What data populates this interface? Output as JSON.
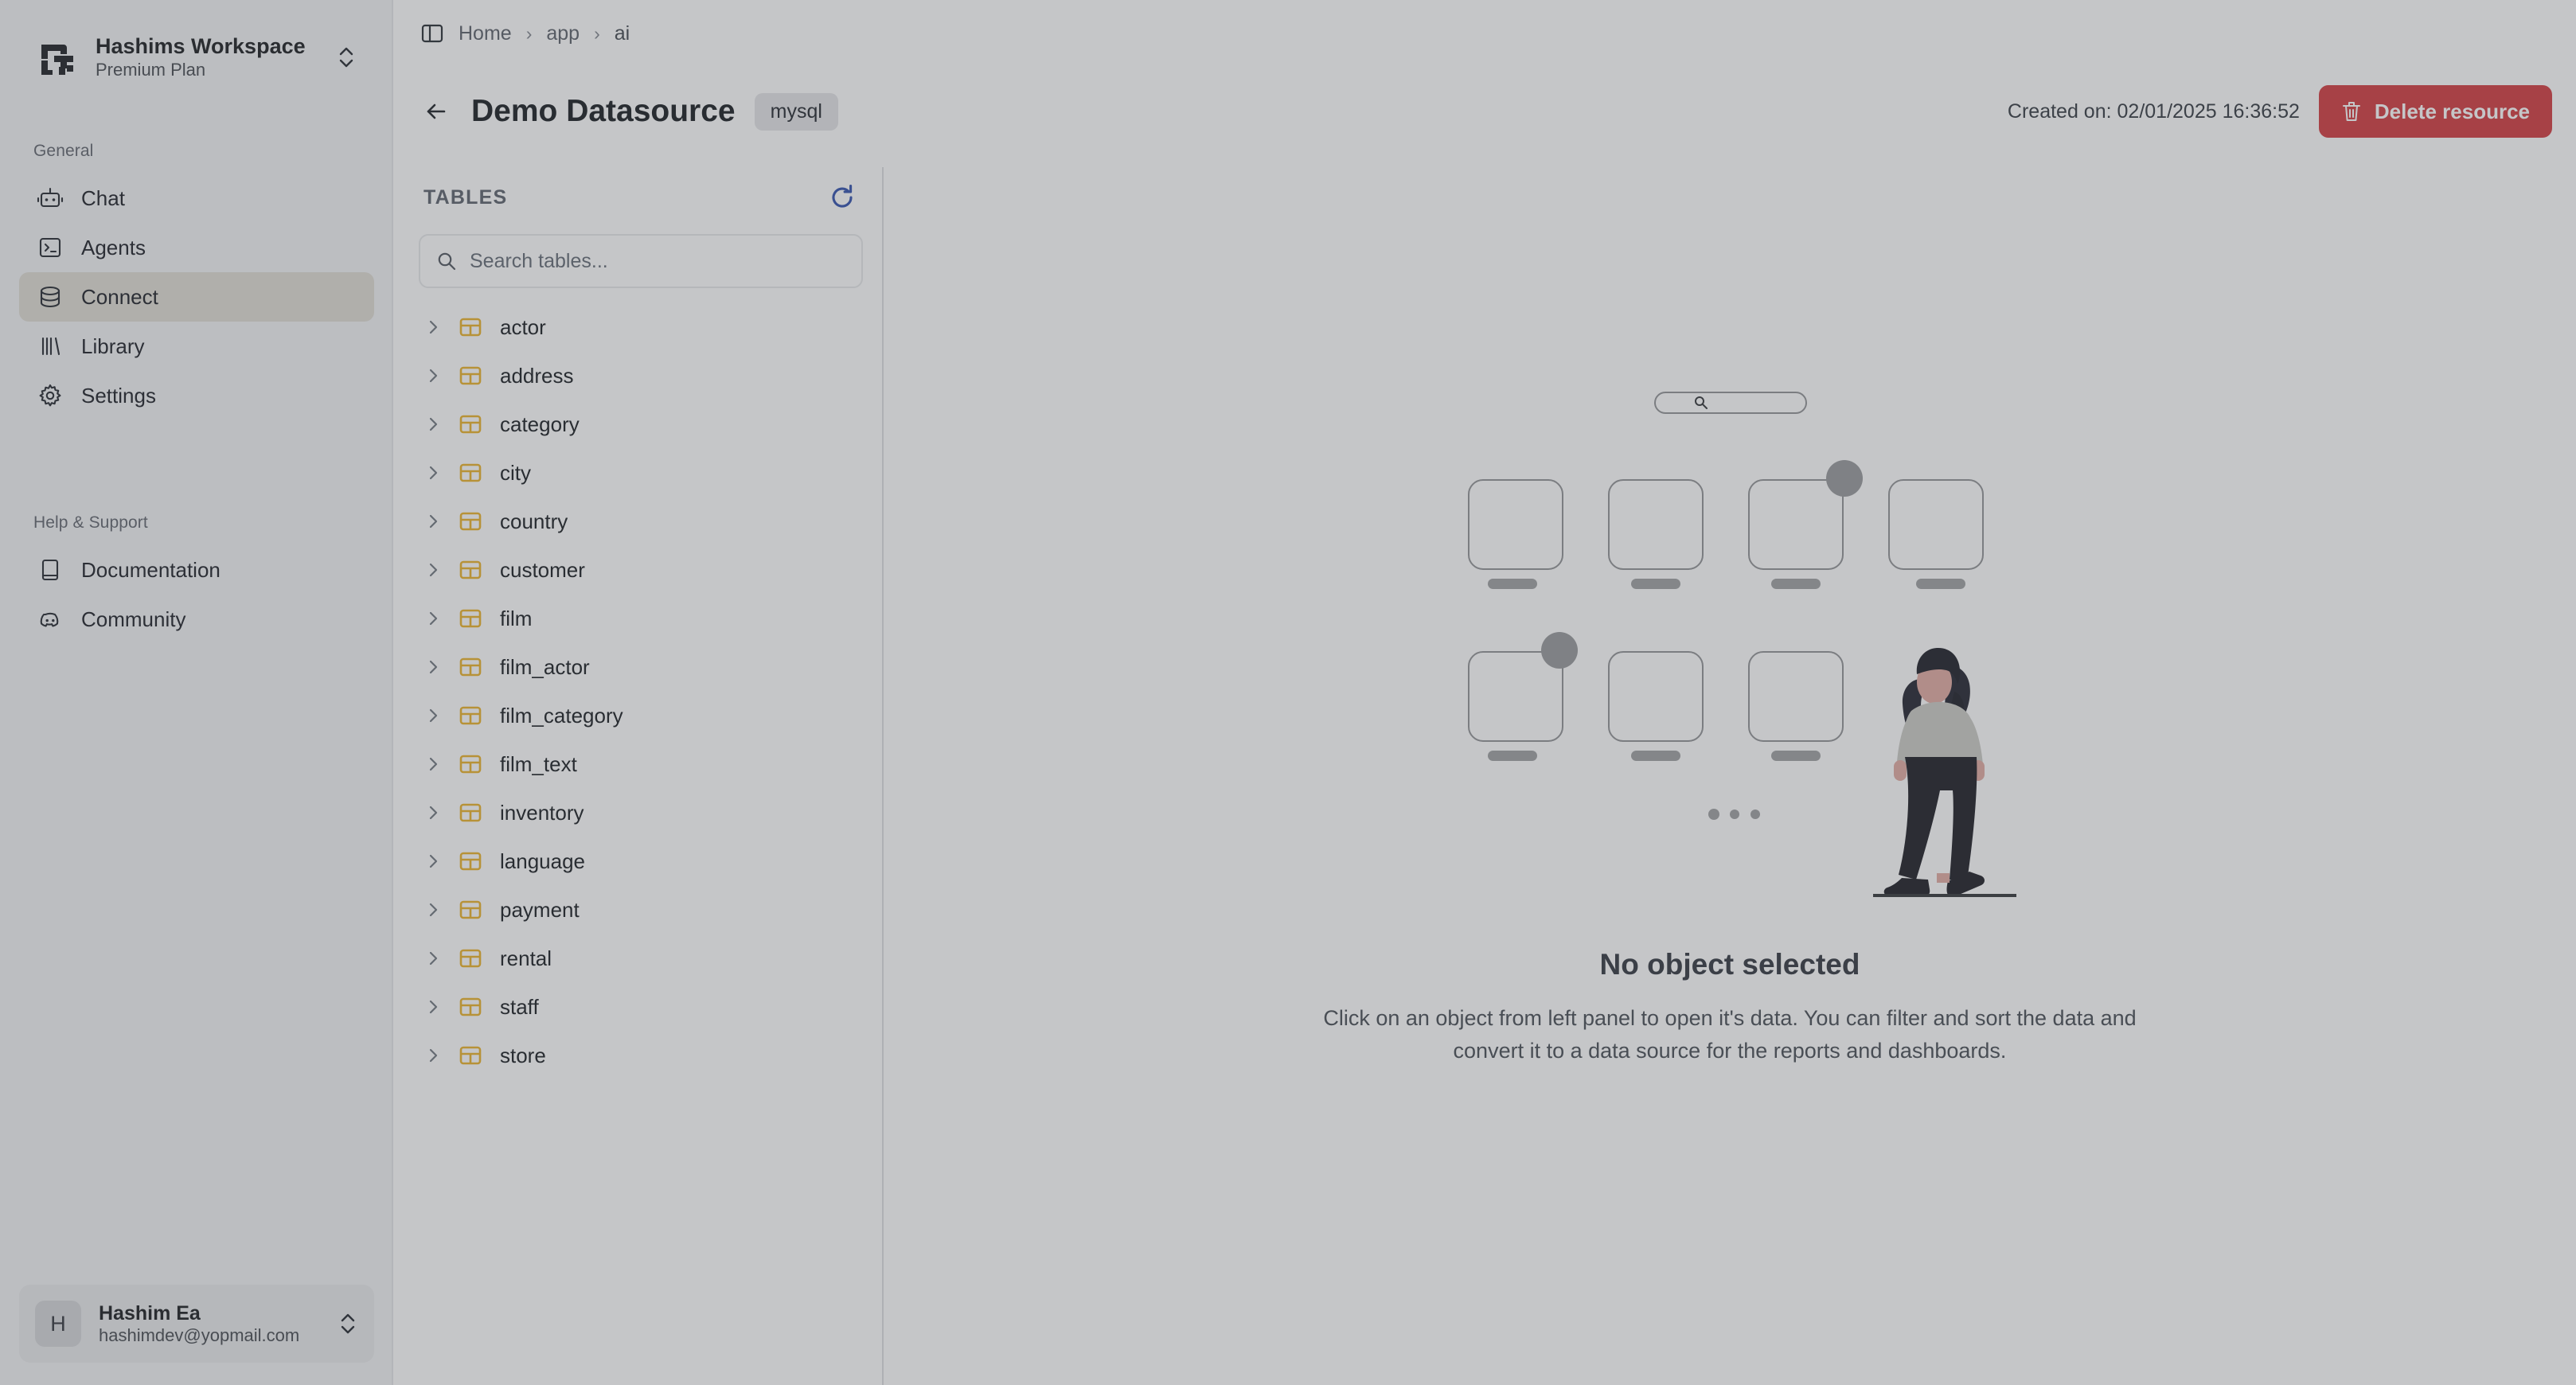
{
  "workspace": {
    "name": "Hashims Workspace",
    "plan": "Premium Plan",
    "logo_icon": "workspace-logo-icon",
    "switcher_icon": "chevron-up-down-icon"
  },
  "sidebar": {
    "sections": [
      {
        "label": "General",
        "items": [
          {
            "label": "Chat",
            "icon": "robot-icon",
            "active": false
          },
          {
            "label": "Agents",
            "icon": "terminal-icon",
            "active": false
          },
          {
            "label": "Connect",
            "icon": "database-icon",
            "active": true
          },
          {
            "label": "Library",
            "icon": "library-bars-icon",
            "active": false
          },
          {
            "label": "Settings",
            "icon": "gear-icon",
            "active": false
          }
        ]
      },
      {
        "label": "Help & Support",
        "items": [
          {
            "label": "Documentation",
            "icon": "book-icon",
            "active": false
          },
          {
            "label": "Community",
            "icon": "discord-icon",
            "active": false
          }
        ]
      }
    ],
    "user": {
      "avatar_initial": "H",
      "name": "Hashim Ea",
      "email": "hashimdev@yopmail.com",
      "switcher_icon": "chevron-up-down-icon"
    }
  },
  "topbar": {
    "panel_toggle_icon": "sidebar-panel-toggle-icon",
    "breadcrumb": [
      "Home",
      "app",
      "ai"
    ],
    "breadcrumb_separator": "›",
    "back_icon": "arrow-left-icon",
    "title": "Demo Datasource",
    "type_badge": "mysql",
    "created_on": "Created on: 02/01/2025 16:36:52",
    "delete_label": "Delete resource",
    "delete_icon": "trash-icon",
    "delete_color": "#d13438"
  },
  "tables_panel": {
    "heading": "TABLES",
    "refresh_icon": "refresh-icon",
    "refresh_color": "#2a4aab",
    "search": {
      "icon": "search-icon",
      "placeholder": "Search tables...",
      "value": ""
    },
    "row_icon": "table-grid-icon",
    "row_icon_color": "#eab022",
    "expand_icon": "chevron-right-icon",
    "tables": [
      "actor",
      "address",
      "category",
      "city",
      "country",
      "customer",
      "film",
      "film_actor",
      "film_category",
      "film_text",
      "inventory",
      "language",
      "payment",
      "rental",
      "staff",
      "store"
    ]
  },
  "empty_state": {
    "illustration": "no-object-selected-illustration",
    "title": "No object selected",
    "description": "Click on an object from left panel to open it's data. You can filter and sort the data and convert it to a data source for the reports and dashboards."
  }
}
